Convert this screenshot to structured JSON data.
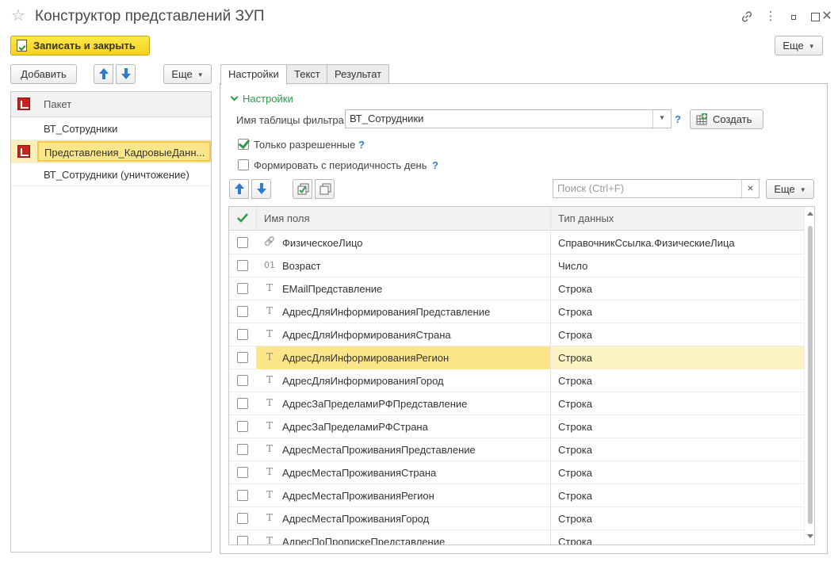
{
  "window": {
    "title": "Конструктор представлений ЗУП",
    "star_glyph": "☆",
    "link_glyph": "🔗",
    "more_glyph": "⋮",
    "minimize_glyph": "▫",
    "maximize_glyph": "□",
    "close_glyph": "✕"
  },
  "toolbar": {
    "save_close_label": "Записать и закрыть",
    "more_label": "Еще"
  },
  "left_panel": {
    "add_label": "Добавить",
    "more_label": "Еще",
    "column_header": "Пакет",
    "items": [
      {
        "label": "ВТ_Сотрудники",
        "icon": false,
        "selected": false
      },
      {
        "label": "Представления_КадровыеДанн...",
        "icon": true,
        "selected": true
      },
      {
        "label": "ВТ_Сотрудники (уничтожение)",
        "icon": false,
        "selected": false
      }
    ]
  },
  "tabs": [
    {
      "label": "Настройки",
      "active": true
    },
    {
      "label": "Текст",
      "active": false
    },
    {
      "label": "Результат",
      "active": false
    }
  ],
  "settings": {
    "group_label": "Настройки",
    "filter_table_label": "Имя таблицы фильтра:",
    "filter_table_value": "ВТ_Сотрудники",
    "help_mark": "?",
    "create_label": "Создать",
    "only_allowed_label": "Только разрешенные",
    "only_allowed_checked": true,
    "periodicity_label": "Формировать с периодичность день",
    "periodicity_checked": false,
    "search_placeholder": "Поиск (Ctrl+F)",
    "clear_glyph": "×",
    "more_label": "Еще"
  },
  "grid": {
    "col_name": "Имя поля",
    "col_type": "Тип данных",
    "rows": [
      {
        "icon": "link",
        "glyph": "🔗",
        "name": "ФизическоеЛицо",
        "type": "СправочникСсылка.ФизическиеЛица",
        "selected": false
      },
      {
        "icon": "number",
        "glyph": "01",
        "name": "Возраст",
        "type": "Число",
        "selected": false
      },
      {
        "icon": "text",
        "glyph": "T",
        "name": "EMailПредставление",
        "type": "Строка",
        "selected": false
      },
      {
        "icon": "text",
        "glyph": "T",
        "name": "АдресДляИнформированияПредставление",
        "type": "Строка",
        "selected": false
      },
      {
        "icon": "text",
        "glyph": "T",
        "name": "АдресДляИнформированияСтрана",
        "type": "Строка",
        "selected": false
      },
      {
        "icon": "text",
        "glyph": "T",
        "name": "АдресДляИнформированияРегион",
        "type": "Строка",
        "selected": true
      },
      {
        "icon": "text",
        "glyph": "T",
        "name": "АдресДляИнформированияГород",
        "type": "Строка",
        "selected": false
      },
      {
        "icon": "text",
        "glyph": "T",
        "name": "АдресЗаПределамиРФПредставление",
        "type": "Строка",
        "selected": false
      },
      {
        "icon": "text",
        "glyph": "T",
        "name": "АдресЗаПределамиРФСтрана",
        "type": "Строка",
        "selected": false
      },
      {
        "icon": "text",
        "glyph": "T",
        "name": "АдресМестаПроживанияПредставление",
        "type": "Строка",
        "selected": false
      },
      {
        "icon": "text",
        "glyph": "T",
        "name": "АдресМестаПроживанияСтрана",
        "type": "Строка",
        "selected": false
      },
      {
        "icon": "text",
        "glyph": "T",
        "name": "АдресМестаПроживанияРегион",
        "type": "Строка",
        "selected": false
      },
      {
        "icon": "text",
        "glyph": "T",
        "name": "АдресМестаПроживанияГород",
        "type": "Строка",
        "selected": false
      },
      {
        "icon": "text",
        "glyph": "T",
        "name": "АдресПоПропискеПредставление",
        "type": "Строка",
        "selected": false
      }
    ]
  },
  "colors": {
    "primary_button": "#f7d21b",
    "selection": "#fde68a",
    "accent_green": "#2f9a48",
    "accent_blue": "#2e7bcf"
  }
}
